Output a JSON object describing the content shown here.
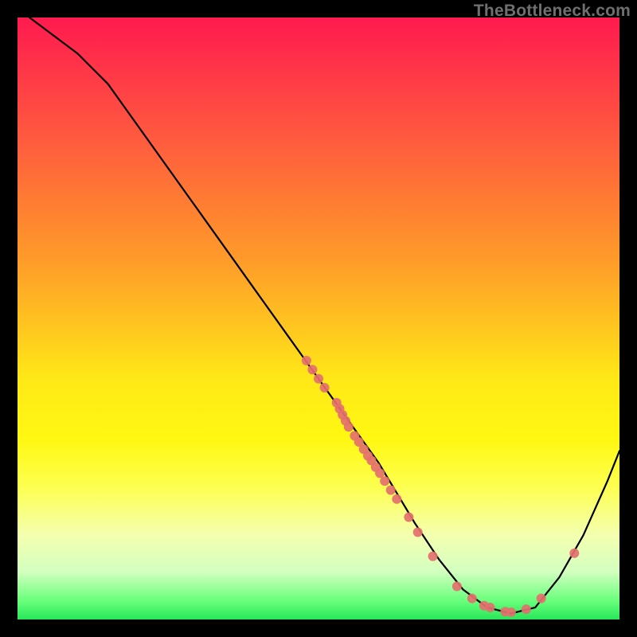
{
  "watermark": "TheBottleneck.com",
  "chart_data": {
    "type": "line",
    "title": "",
    "xlabel": "",
    "ylabel": "",
    "xlim": [
      0,
      100
    ],
    "ylim": [
      0,
      100
    ],
    "background_gradient": {
      "orientation": "vertical",
      "stops": [
        {
          "pos": 0,
          "color": "#ff1a4f"
        },
        {
          "pos": 50,
          "color": "#ffe817"
        },
        {
          "pos": 95,
          "color": "#66ff7a"
        },
        {
          "pos": 100,
          "color": "#28e65a"
        }
      ]
    },
    "series": [
      {
        "name": "bottleneck-curve",
        "color": "#000000",
        "x": [
          2,
          6,
          10,
          15,
          20,
          25,
          30,
          35,
          40,
          45,
          50,
          55,
          60,
          63,
          66,
          70,
          74,
          78,
          82,
          86,
          90,
          94,
          98,
          100
        ],
        "y": [
          100,
          97,
          94,
          89,
          82,
          75,
          68,
          61,
          54,
          47,
          40,
          33,
          26,
          21,
          16,
          10,
          5,
          2,
          1,
          2,
          7,
          14,
          23,
          28
        ]
      }
    ],
    "scatter": [
      {
        "name": "data-points",
        "color": "#e4706e",
        "radius": 6,
        "points": [
          {
            "x": 48,
            "y": 43
          },
          {
            "x": 49,
            "y": 41.5
          },
          {
            "x": 50,
            "y": 40
          },
          {
            "x": 51,
            "y": 38.5
          },
          {
            "x": 53,
            "y": 36
          },
          {
            "x": 53.5,
            "y": 35
          },
          {
            "x": 54,
            "y": 34
          },
          {
            "x": 54.5,
            "y": 33
          },
          {
            "x": 55,
            "y": 32
          },
          {
            "x": 56,
            "y": 30.5
          },
          {
            "x": 56.7,
            "y": 29.5
          },
          {
            "x": 57.5,
            "y": 28.3
          },
          {
            "x": 58.2,
            "y": 27.2
          },
          {
            "x": 58.8,
            "y": 26.4
          },
          {
            "x": 59.5,
            "y": 25.3
          },
          {
            "x": 60.2,
            "y": 24.3
          },
          {
            "x": 61,
            "y": 23
          },
          {
            "x": 62,
            "y": 21.5
          },
          {
            "x": 63,
            "y": 20
          },
          {
            "x": 65,
            "y": 17
          },
          {
            "x": 66.5,
            "y": 14.5
          },
          {
            "x": 69,
            "y": 10.5
          },
          {
            "x": 73,
            "y": 5.5
          },
          {
            "x": 75.5,
            "y": 3.5
          },
          {
            "x": 77.5,
            "y": 2.3
          },
          {
            "x": 78.5,
            "y": 2
          },
          {
            "x": 81,
            "y": 1.3
          },
          {
            "x": 82,
            "y": 1.2
          },
          {
            "x": 84.5,
            "y": 1.7
          },
          {
            "x": 87,
            "y": 3.5
          },
          {
            "x": 92.5,
            "y": 11
          }
        ]
      }
    ]
  }
}
